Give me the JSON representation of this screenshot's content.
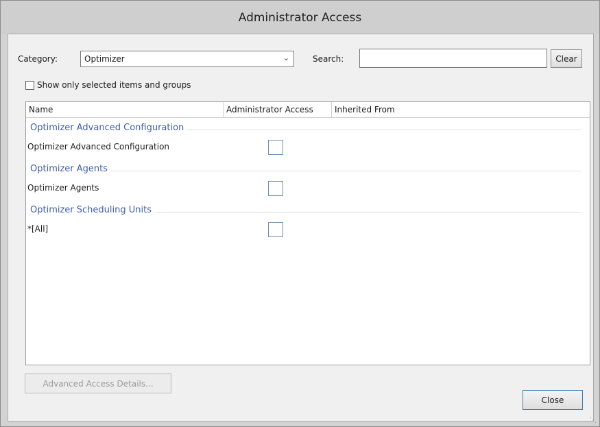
{
  "window": {
    "title": "Administrator Access"
  },
  "filters": {
    "category_label": "Category:",
    "category_value": "Optimizer",
    "search_label": "Search:",
    "search_value": "",
    "clear_label": "Clear",
    "show_selected_label": "Show only selected items and groups",
    "show_selected_checked": false
  },
  "grid": {
    "columns": [
      "Name",
      "Administrator Access",
      "Inherited From"
    ],
    "groups": [
      {
        "title": "Optimizer Advanced Configuration",
        "rows": [
          {
            "name": "Optimizer Advanced Configuration",
            "admin_access": false,
            "inherited_from": ""
          }
        ]
      },
      {
        "title": "Optimizer Agents",
        "rows": [
          {
            "name": "Optimizer Agents",
            "admin_access": false,
            "inherited_from": ""
          }
        ]
      },
      {
        "title": "Optimizer Scheduling Units",
        "rows": [
          {
            "name": "*[All]",
            "admin_access": false,
            "inherited_from": ""
          }
        ]
      }
    ]
  },
  "footer": {
    "advanced_label": "Advanced Access Details...",
    "close_label": "Close"
  }
}
